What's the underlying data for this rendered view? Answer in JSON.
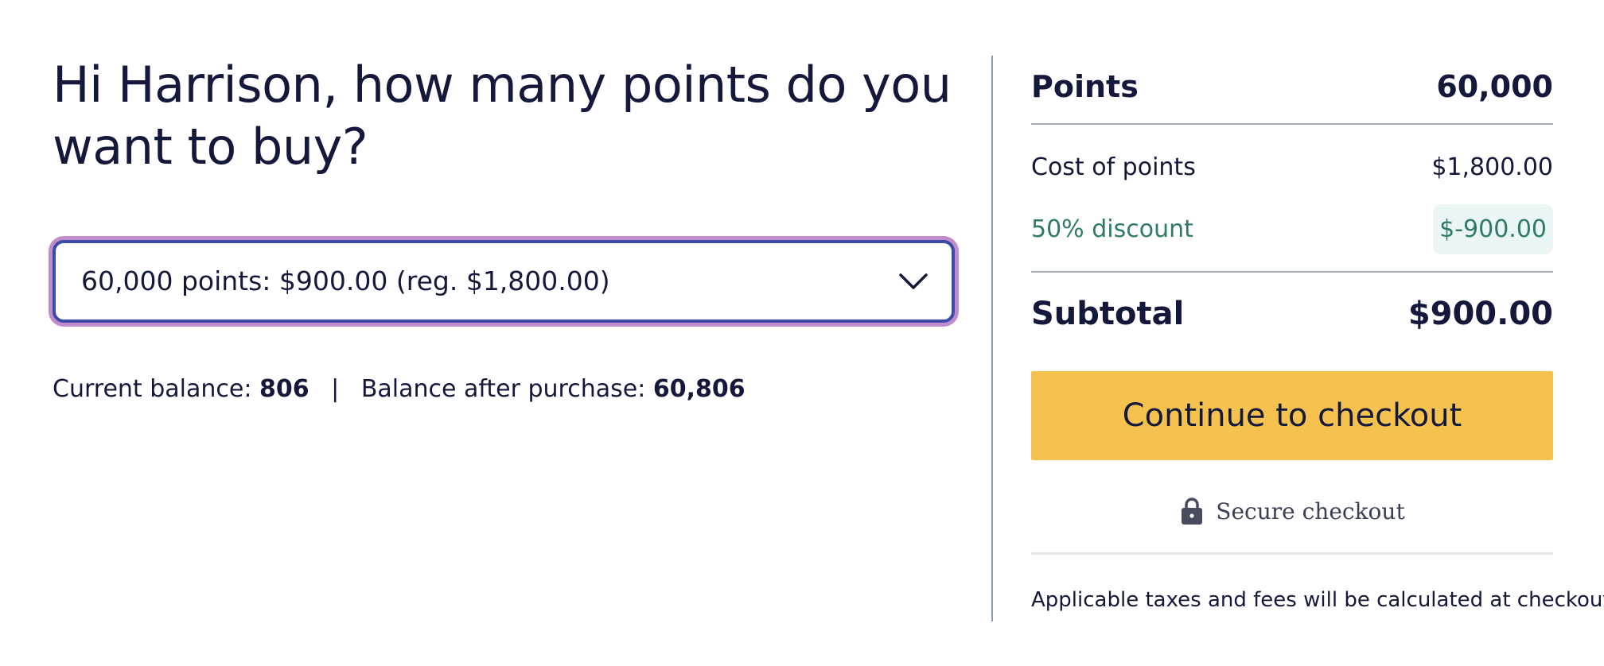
{
  "heading": "Hi Harrison, how many points do you want to buy?",
  "points_select": {
    "selected": "60,000 points: $900.00 (reg. $1,800.00)"
  },
  "balance": {
    "current_label": "Current balance:",
    "current_value": "806",
    "separator": "|",
    "after_label": "Balance after purchase:",
    "after_value": "60,806"
  },
  "summary": {
    "points_label": "Points",
    "points_value": "60,000",
    "cost_label": "Cost of points",
    "cost_value": "$1,800.00",
    "discount_label": "50% discount",
    "discount_value": "$-900.00",
    "subtotal_label": "Subtotal",
    "subtotal_value": "$900.00",
    "checkout_button": "Continue to checkout",
    "secure_label": "Secure checkout",
    "taxes_note": "Applicable taxes and fees will be calculated at checkout."
  },
  "icons": {
    "chevron": "chevron-down-icon",
    "lock": "lock-icon"
  },
  "colors": {
    "text": "#14193b",
    "select_border": "#3a4aa6",
    "select_focus_ring": "#c08ccc",
    "discount_text": "#2f7a6a",
    "discount_bg": "#eaf6f4",
    "checkout_button_bg": "#f5c24f",
    "divider": "#8e9bb5"
  }
}
